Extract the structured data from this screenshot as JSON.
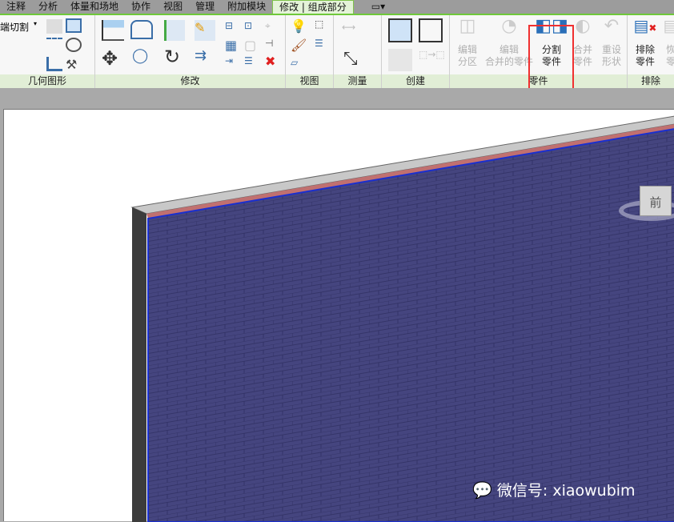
{
  "tabs": [
    "注释",
    "分析",
    "体量和场地",
    "协作",
    "视图",
    "管理",
    "附加模块",
    "修改 | 组成部分"
  ],
  "ribbon": {
    "geometry": {
      "label": "几何图形",
      "cut_label": "端切割"
    },
    "modify": {
      "label": "修改"
    },
    "view": {
      "label": "视图"
    },
    "measure": {
      "label": "测量"
    },
    "create": {
      "label": "创建"
    },
    "parts": {
      "label": "零件",
      "buttons": [
        {
          "line1": "编辑",
          "line2": "分区",
          "enabled": false
        },
        {
          "line1": "编辑",
          "line2": "合并的零件",
          "enabled": false
        },
        {
          "line1": "分割",
          "line2": "零件",
          "enabled": true,
          "highlighted": true
        },
        {
          "line1": "合并",
          "line2": "零件",
          "enabled": false
        },
        {
          "line1": "重设",
          "line2": "形状",
          "enabled": false
        }
      ]
    },
    "exclude": {
      "label": "排除",
      "buttons": [
        {
          "line1": "排除",
          "line2": "零件"
        },
        {
          "line1": "恢",
          "line2": "零"
        }
      ]
    }
  },
  "viewcube": {
    "face": "前"
  },
  "watermark": "微信号: xiaowubim",
  "colors": {
    "wall": "#45457f",
    "accent": "#6fc83a",
    "highlight": "#f03030"
  }
}
